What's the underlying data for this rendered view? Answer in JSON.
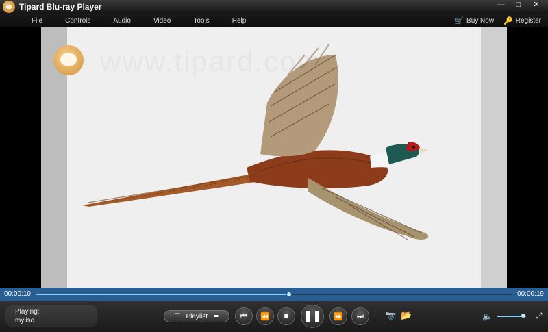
{
  "window": {
    "title": "Tipard Blu-ray Player"
  },
  "menu": {
    "items": [
      "File",
      "Controls",
      "Audio",
      "Video",
      "Tools",
      "Help"
    ],
    "buy_now": "Buy Now",
    "register": "Register"
  },
  "player": {
    "watermark": "www.tipard.com",
    "time_elapsed": "00:00:10",
    "time_total": "00:00:19",
    "progress": 0.53,
    "volume": 0.9,
    "playing_label": "Playing:",
    "playing_file": "my.iso",
    "playlist_label": "Playlist"
  },
  "icons": {
    "minimize": "minimize-icon",
    "maximize": "maximize-icon",
    "close": "close-icon",
    "cart": "cart-icon",
    "key": "key-icon",
    "prev": "previous-icon",
    "rewind": "rewind-icon",
    "stop": "stop-icon",
    "pause": "pause-icon",
    "forward": "fast-forward-icon",
    "next": "next-icon",
    "camera": "camera-icon",
    "folder": "folder-icon",
    "speaker": "speaker-icon",
    "fullscreen": "fullscreen-icon"
  },
  "colors": {
    "accent": "#2a5d91",
    "progress_fill": "#8bd1ff"
  }
}
